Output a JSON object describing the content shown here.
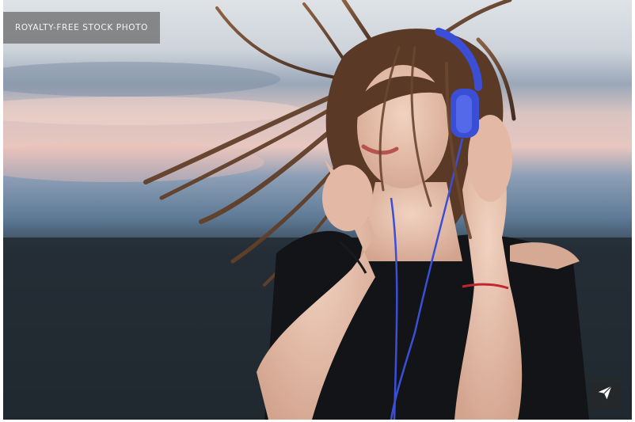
{
  "badge": {
    "label": "ROYALTY-FREE STOCK PHOTO"
  },
  "photo": {
    "icon": "photo-image"
  },
  "share": {
    "icon": "paper-plane-icon"
  },
  "colors": {
    "badge_bg": "#6e6e6e",
    "headphones": "#3b4fd6",
    "share_icon": "#ffffff"
  }
}
